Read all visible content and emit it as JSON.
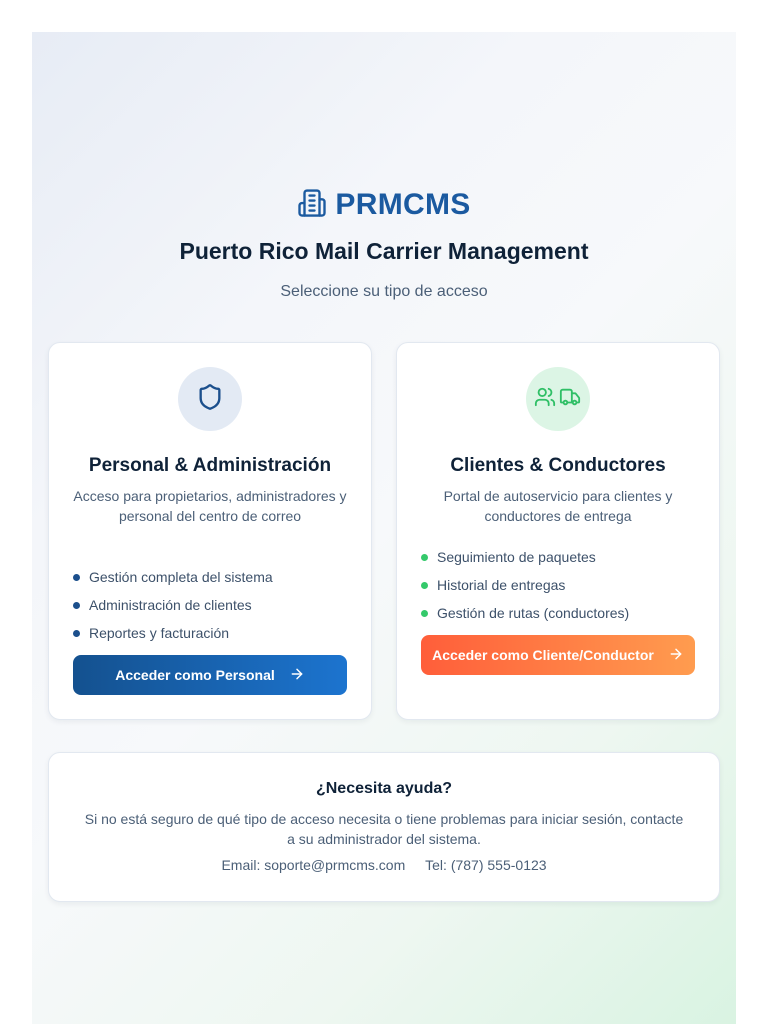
{
  "header": {
    "brand": "PRMCMS",
    "subtitle": "Puerto Rico Mail Carrier Management",
    "tagline": "Seleccione su tipo de acceso"
  },
  "cards": [
    {
      "icon": "shield-icon",
      "title": "Personal & Administración",
      "description": "Acceso para propietarios, administradores y personal del centro de correo",
      "features": [
        "Gestión completa del sistema",
        "Administración de clientes",
        "Reportes y facturación"
      ],
      "button_label": "Acceder como Personal",
      "accent": "#1b4f8c"
    },
    {
      "icon": "users-truck-icon",
      "title": "Clientes & Conductores",
      "description": "Portal de autoservicio para clientes y conductores de entrega",
      "features": [
        "Seguimiento de paquetes",
        "Historial de entregas",
        "Gestión de rutas (conductores)"
      ],
      "button_label": "Acceder como Cliente/Conductor",
      "accent": "#ff6a3d"
    }
  ],
  "help": {
    "title": "¿Necesita ayuda?",
    "text": "Si no está seguro de qué tipo de acceso necesita o tiene problemas para iniciar sesión, contacte a su administrador del sistema.",
    "email": "Email: soporte@prmcms.com",
    "phone": "Tel: (787) 555-0123"
  },
  "colors": {
    "brand": "#1b5aa0",
    "success": "#34c96b",
    "text": "#0f2238",
    "muted": "#4b5f77"
  }
}
